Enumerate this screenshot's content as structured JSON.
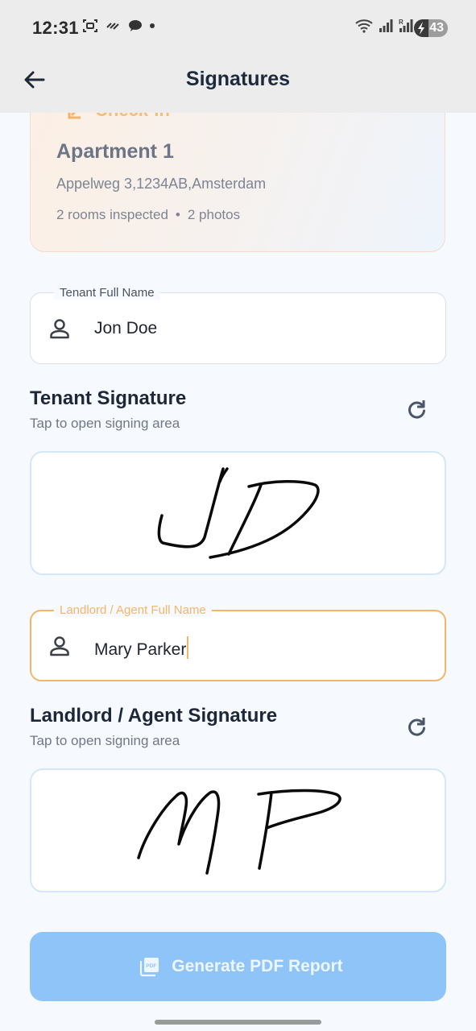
{
  "status_bar": {
    "time": "12:31",
    "battery": "43",
    "icons_left": [
      "screenshot-icon",
      "missed-call-icon",
      "chat-icon",
      "notification-dot-icon"
    ],
    "icons_right": [
      "wifi-icon",
      "signal-icon",
      "signal-r-icon",
      "battery-icon"
    ]
  },
  "app_bar": {
    "title": "Signatures",
    "back_icon": "arrow-back-icon"
  },
  "inspection_card": {
    "type_label": "Check-in",
    "property_name": "Apartment 1",
    "address": "Appelweg 3,1234AB,Amsterdam",
    "rooms": "2 rooms inspected",
    "separator": "•",
    "photos": "2 photos"
  },
  "tenant": {
    "name_label": "Tenant Full Name",
    "name_value": "Jon Doe",
    "signature_title": "Tenant Signature",
    "signature_hint": "Tap to open signing area",
    "signature_initials": "JD"
  },
  "landlord": {
    "name_label": "Landlord / Agent Full Name",
    "name_value": "Mary Parker",
    "signature_title": "Landlord / Agent Signature",
    "signature_hint": "Tap to open signing area",
    "signature_initials": "MP"
  },
  "actions": {
    "generate_pdf": "Generate PDF Report",
    "generate_pdf_icon": "pdf-icon"
  },
  "colors": {
    "accent_orange": "#f2b66a",
    "button_blue": "#8fc4f8",
    "sig_border": "#d5e7f6",
    "text_dark": "#1d2738"
  }
}
